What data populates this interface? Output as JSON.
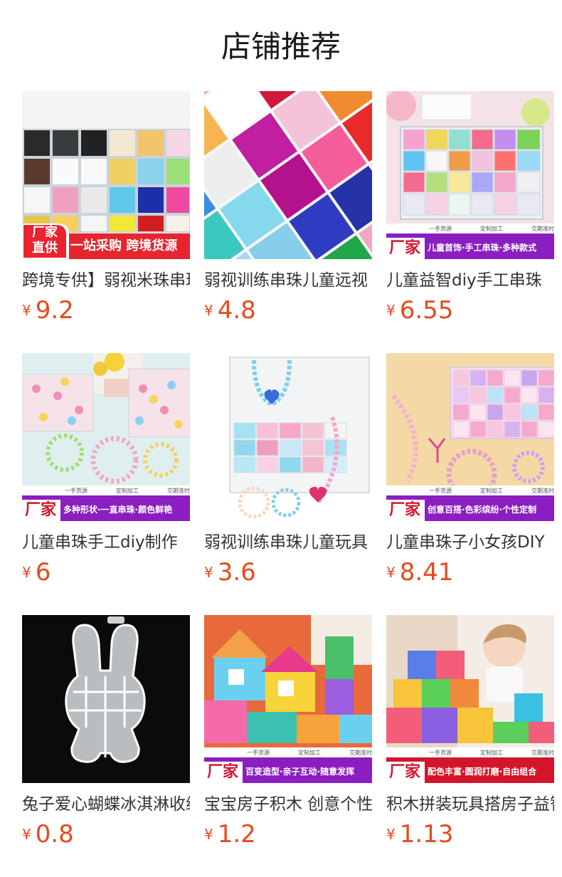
{
  "header": {
    "title": "店铺推荐"
  },
  "currency": "¥",
  "products": [
    {
      "name": "跨境专供】弱视米珠串珠儿童",
      "price": "9.2",
      "banner_badge": "厂家直供",
      "banner_text": "一站采购 跨境货源"
    },
    {
      "name": "弱视训练串珠儿童远视",
      "price": "4.8"
    },
    {
      "name": "儿童益智diy手工串珠",
      "price": "6.55",
      "banner_badge": "厂家",
      "banner_text": "儿童首饰·手工串珠·多种款式",
      "banner_strip": [
        "一手货源",
        "定制加工",
        "交期准时"
      ]
    },
    {
      "name": "儿童串珠手工diy制作",
      "price": "6",
      "banner_badge": "厂家",
      "banner_text": "多种形状·一直串珠·颜色鲜艳",
      "banner_strip": [
        "一手货源",
        "定制加工",
        "交期准时"
      ]
    },
    {
      "name": "弱视训练串珠儿童玩具",
      "price": "3.6"
    },
    {
      "name": "儿童串珠子小女孩DIY",
      "price": "8.41",
      "banner_badge": "厂家",
      "banner_text": "创意百搭·色彩缤纷·个性定制",
      "banner_strip": [
        "一手货源",
        "定制加工",
        "交期准时"
      ]
    },
    {
      "name": "兔子爱心蝴蝶冰淇淋收纳盒",
      "price": "0.8"
    },
    {
      "name": "宝宝房子积木 创意个性",
      "price": "1.2",
      "banner_badge": "厂家",
      "banner_text": "百变造型·亲子互动·随意发挥",
      "banner_strip": [
        "一手货源",
        "定制加工",
        "交期准时"
      ]
    },
    {
      "name": "积木拼装玩具搭房子益智",
      "price": "1.13",
      "banner_badge": "厂家",
      "banner_text": "配色丰富·圆润打磨·自由组合",
      "banner_strip": [
        "一手货源",
        "定制加工",
        "交期准时"
      ]
    }
  ]
}
